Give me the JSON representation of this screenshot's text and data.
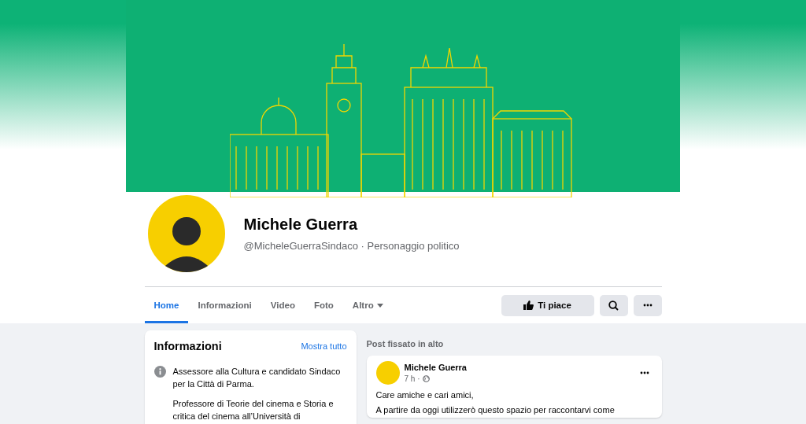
{
  "profile": {
    "name": "Michele Guerra",
    "subtitle": "@MicheleGuerraSindaco · Personaggio politico"
  },
  "tabs": [
    {
      "label": "Home",
      "selected": true
    },
    {
      "label": "Informazioni",
      "selected": false
    },
    {
      "label": "Video",
      "selected": false
    },
    {
      "label": "Foto",
      "selected": false
    },
    {
      "label": "Altro",
      "selected": false,
      "kind": "dropdown"
    }
  ],
  "actions": {
    "like": "Ti piace"
  },
  "about": {
    "title": "Informazioni",
    "link": "Mostra tutto",
    "paragraphs": [
      "Assessore alla Cultura e candidato Sindaco per la Città di Parma.",
      "Professore di Teorie del cinema e Storia e critica del cinema all’Università di"
    ]
  },
  "pinned": {
    "heading": "Post fissato in alto",
    "author": "Michele Guerra",
    "time": "7 h ·",
    "lines": [
      "Care amiche e cari amici,",
      "A partire da oggi utilizzerò questo spazio per raccontarvi come"
    ]
  }
}
